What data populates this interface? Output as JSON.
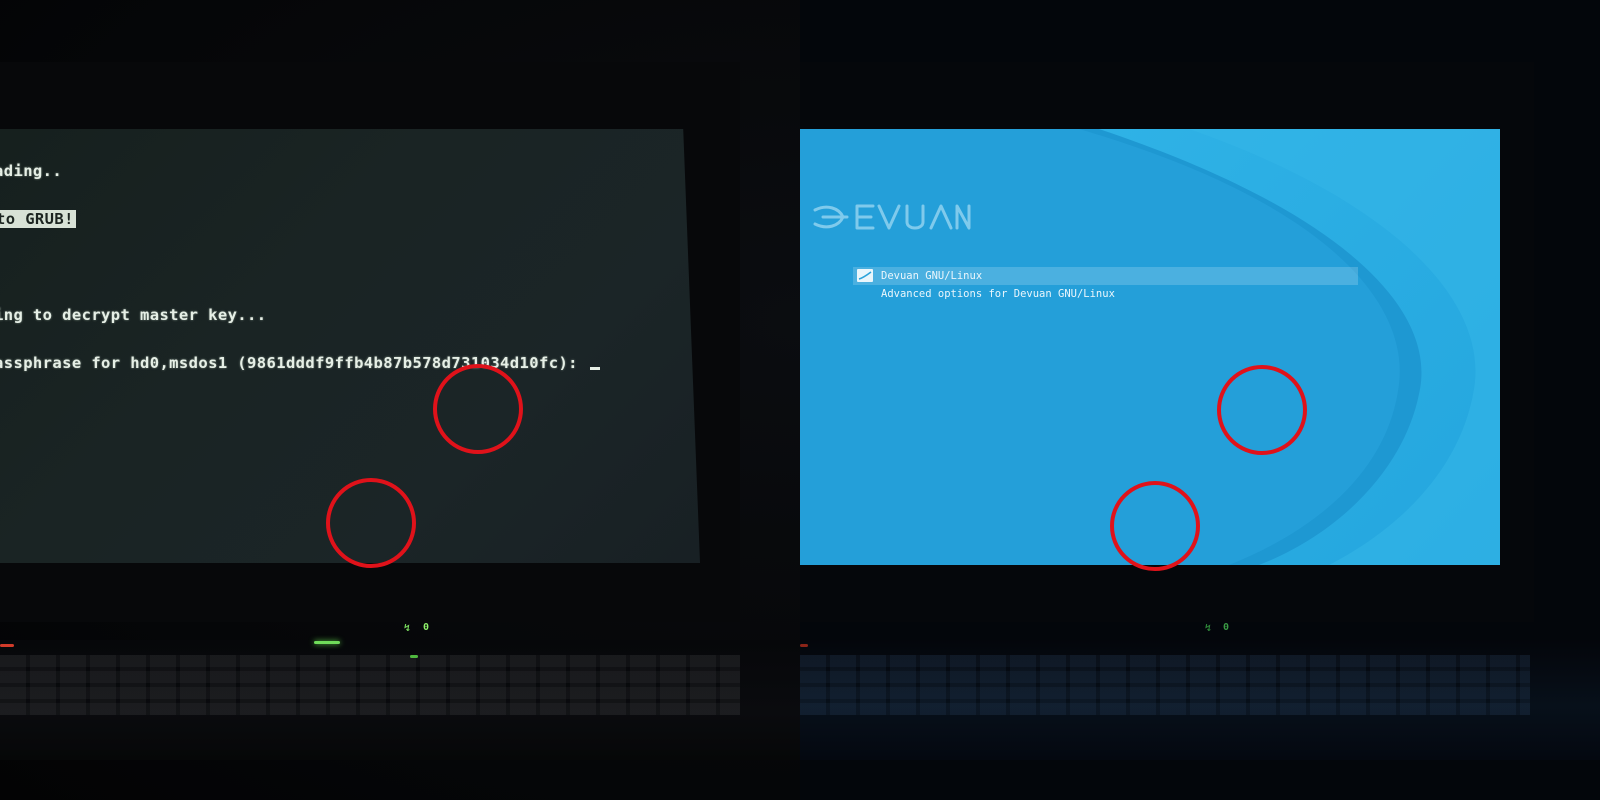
{
  "terminal": {
    "lines": [
      "ading..",
      "",
      "ing to decrypt master key...",
      "assphrase for hd0,msdos1 (9861dddf9ffb4b87b578d731034d10fc): "
    ],
    "highlight_text": "to GRUB!"
  },
  "grub": {
    "logo_text": "DEVUAN",
    "entries": [
      {
        "label": "Devuan GNU/Linux",
        "selected": true
      },
      {
        "label": "Advanced options for Devuan GNU/Linux",
        "selected": false
      }
    ]
  },
  "indicators": {
    "left_led": "0",
    "right_led": "0"
  },
  "colors": {
    "annotation_red": "#e0121a",
    "grub_background": "#2aa3db",
    "terminal_text": "#e6efe6"
  }
}
